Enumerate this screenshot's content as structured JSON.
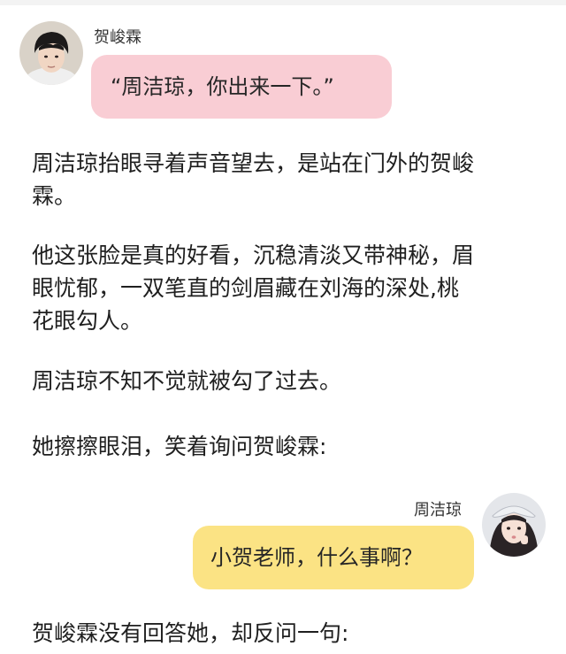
{
  "chat": {
    "left": {
      "name": "贺峻霖",
      "text": "“周洁琼，你出来一下。”"
    },
    "right": {
      "name": "周洁琼",
      "text": "小贺老师，什么事啊？"
    }
  },
  "story": {
    "p1_line1": "周洁琼抬眼寻着声音望去，是站在门外的贺峻",
    "p1_line2": "霖。",
    "p2_line1": "他这张脸是真的好看，沉稳清淡又带神秘，眉",
    "p2_line2": "眼忧郁，一双笔直的剑眉藏在刘海的深处,桃",
    "p2_line3": "花眼勾人。",
    "p3": "周洁琼不知不觉就被勾了过去。",
    "p4": "她擦擦眼泪，笑着询问贺峻霖:",
    "p5": "贺峻霖没有回答她，却反问一句:"
  },
  "colors": {
    "left_bubble": "#f9cdd4",
    "right_bubble": "#fbe384"
  }
}
